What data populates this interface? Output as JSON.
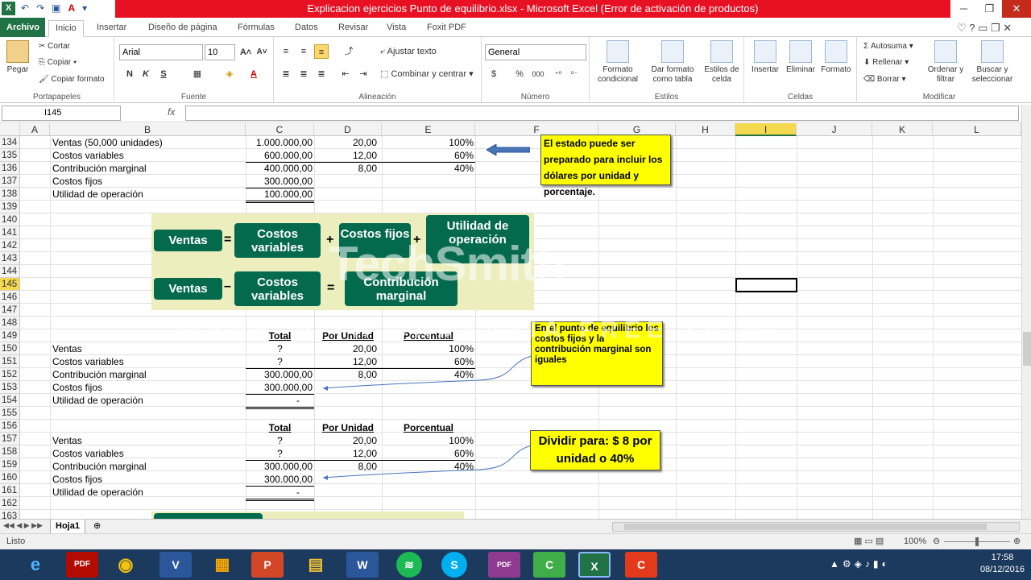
{
  "window": {
    "title": "Explicacion ejercicios Punto de equilibrio.xlsx -  Microsoft Excel (Error de activación de productos)"
  },
  "tabs": [
    "Archivo",
    "Inicio",
    "Insertar",
    "Diseño de página",
    "Fórmulas",
    "Datos",
    "Revisar",
    "Vista",
    "Foxit PDF"
  ],
  "ribbon": {
    "clipboard": {
      "paste": "Pegar",
      "cut": "Cortar",
      "copy": "Copiar",
      "format_painter": "Copiar formato",
      "label": "Portapapeles"
    },
    "font": {
      "name": "Arial",
      "size": "10",
      "label": "Fuente",
      "bold": "N",
      "italic": "K",
      "underline": "S"
    },
    "alignment": {
      "wrap": "Ajustar texto",
      "merge": "Combinar y centrar",
      "label": "Alineación"
    },
    "number": {
      "format": "General",
      "label": "Número",
      "currency": "$",
      "percent": "%",
      "thousands": "000"
    },
    "styles": {
      "conditional": "Formato condicional",
      "as_table": "Dar formato como tabla",
      "cell_styles": "Estilos de celda",
      "label": "Estilos"
    },
    "cells": {
      "insert": "Insertar",
      "delete": "Eliminar",
      "format": "Formato",
      "label": "Celdas"
    },
    "editing": {
      "autosum": "Autosuma",
      "fill": "Rellenar",
      "clear": "Borrar",
      "sort": "Ordenar y filtrar",
      "find": "Buscar y seleccionar",
      "label": "Modificar"
    }
  },
  "formula_bar": {
    "name_box": "I145",
    "fx": "fx",
    "content": ""
  },
  "columns": [
    "A",
    "B",
    "C",
    "D",
    "E",
    "F",
    "G",
    "H",
    "I",
    "J",
    "K",
    "L"
  ],
  "rows": [
    "134",
    "135",
    "136",
    "137",
    "138",
    "139",
    "140",
    "141",
    "142",
    "143",
    "144",
    "145",
    "146",
    "147",
    "148",
    "149",
    "150",
    "151",
    "152",
    "153",
    "154",
    "155",
    "156",
    "157",
    "158",
    "159",
    "160",
    "161",
    "162",
    "163"
  ],
  "cells": {
    "r134": {
      "b": "Ventas (50,000 unidades)",
      "c": "1.000.000,00",
      "d": "20,00",
      "e": "100%"
    },
    "r135": {
      "b": "Costos variables",
      "c": "600.000,00",
      "d": "12,00",
      "e": "60%"
    },
    "r136": {
      "b": "Contribución marginal",
      "c": "400.000,00",
      "d": "8,00",
      "e": "40%"
    },
    "r137": {
      "b": "Costos fijos",
      "c": "300.000,00"
    },
    "r138": {
      "b": "Utilidad de operación",
      "c": "100.000,00"
    },
    "r149": {
      "c": "Total",
      "d": "Por Unidad",
      "e": "Porcentual"
    },
    "r150": {
      "b": "Ventas",
      "c": "?",
      "d": "20,00",
      "e": "100%"
    },
    "r151": {
      "b": "Costos variables",
      "c": "?",
      "d": "12,00",
      "e": "60%"
    },
    "r152": {
      "b": "Contribución marginal",
      "c": "300.000,00",
      "d": "8,00",
      "e": "40%"
    },
    "r153": {
      "b": "Costos fijos",
      "c": "300.000,00"
    },
    "r154": {
      "b": "Utilidad de operación",
      "c": "-"
    },
    "r156": {
      "c": "Total",
      "d": "Por Unidad",
      "e": "Porcentual"
    },
    "r157": {
      "b": "Ventas",
      "c": "?",
      "d": "20,00",
      "e": "100%"
    },
    "r158": {
      "b": "Costos variables",
      "c": "?",
      "d": "12,00",
      "e": "60%"
    },
    "r159": {
      "b": "Contribución marginal",
      "c": "300.000,00",
      "d": "8,00",
      "e": "40%"
    },
    "r160": {
      "b": "Costos fijos",
      "c": "300.000,00"
    },
    "r161": {
      "b": "Utilidad de operación",
      "c": "-"
    }
  },
  "callouts": {
    "c1": "El estado puede ser preparado para incluir los dólares por unidad y porcentaje.",
    "c2": "En el punto de equilibrio los costos fijos y la contribución marginal son iguales",
    "c3": "Dividir para: $ 8 por unidad o 40%"
  },
  "equation": {
    "ventas": "Ventas",
    "costos_variables": "Costos variables",
    "costos_fijos": "Costos fijos",
    "utilidad": "Utilidad de operación",
    "contribucion": "Contribución marginal",
    "eq": "=",
    "plus": "+",
    "minus": "–"
  },
  "watermark": {
    "logo": "TechSmith",
    "trial": "MADE WITH CAMTASIA FREE TRIAL"
  },
  "sheet_tab": "Hoja1",
  "status": {
    "mode": "Listo",
    "zoom": "100%"
  },
  "clock": {
    "time": "17:58",
    "date": "08/12/2016"
  },
  "taskbar_apps": [
    "e",
    "PDF",
    "◉",
    "V",
    "▦",
    "P",
    "▤",
    "W",
    "≋",
    "S",
    "PDF",
    "C",
    "X",
    "C"
  ]
}
